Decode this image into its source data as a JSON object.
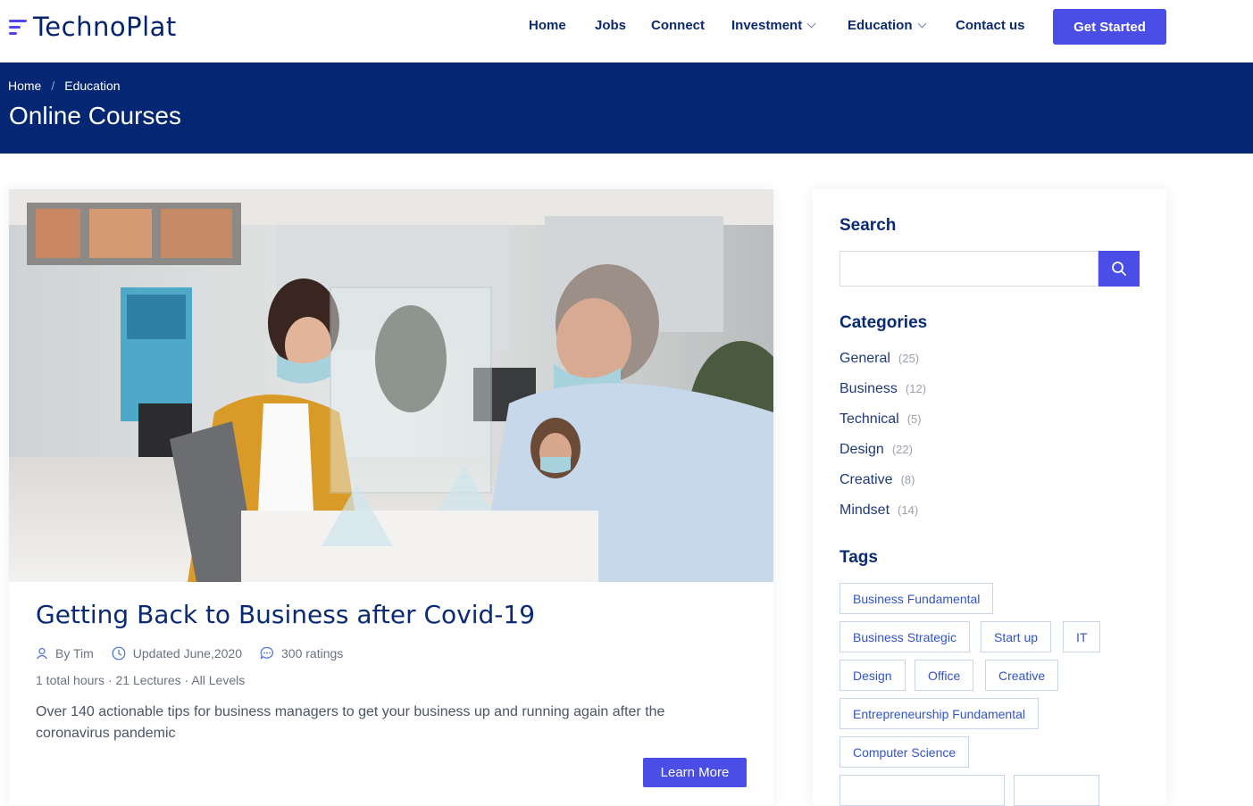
{
  "brand": {
    "name": "TechnoPlat"
  },
  "nav": {
    "items": [
      {
        "label": "Home"
      },
      {
        "label": "Jobs"
      },
      {
        "label": "Connect"
      },
      {
        "label": "Investment"
      },
      {
        "label": "Education"
      },
      {
        "label": "Contact us"
      }
    ],
    "cta_label": "Get Started"
  },
  "banner": {
    "breadcrumb": [
      "Home",
      "Education"
    ],
    "breadcrumb_separator": "/",
    "title": "Online Courses"
  },
  "course": {
    "title": "Getting Back to Business after Covid-19",
    "author": "By Tim",
    "updated": "Updated June,2020",
    "ratings": "300 ratings",
    "stats": "1 total hours · 21 Lectures · All Levels",
    "description": "Over 140 actionable tips for business managers to get your business up and running again after the coronavirus pandemic",
    "button_label": "Learn More"
  },
  "sidebar": {
    "search_heading": "Search",
    "search_value": "",
    "categories_heading": "Categories",
    "categories": [
      {
        "name": "General",
        "count": "(25)"
      },
      {
        "name": "Business",
        "count": "(12)"
      },
      {
        "name": "Technical",
        "count": "(5)"
      },
      {
        "name": "Design",
        "count": "(22)"
      },
      {
        "name": "Creative",
        "count": "(8)"
      },
      {
        "name": "Mindset",
        "count": "(14)"
      }
    ],
    "tags_heading": "Tags",
    "tags": [
      "Business Fundamental",
      "Business Strategic",
      "Start up",
      "IT",
      "Design",
      "Office",
      "Creative",
      "Entrepreneurship Fundamental",
      "Computer Science"
    ]
  },
  "colors": {
    "primary": "#4a4de6",
    "navy": "#052773",
    "heading": "#0a2b74"
  }
}
